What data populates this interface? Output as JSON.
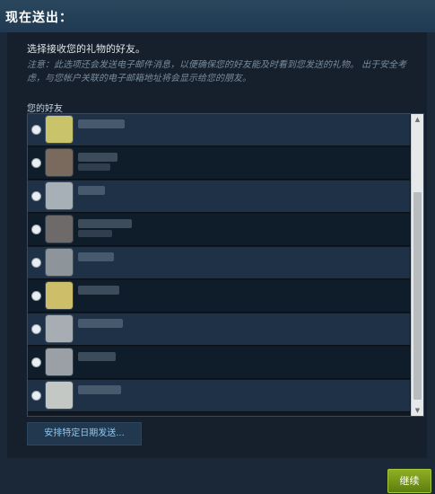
{
  "header": {
    "title": "现在送出："
  },
  "instructions": {
    "title": "选择接收您的礼物的好友。",
    "note": "注意：此选项还会发送电子邮件消息，以便确保您的好友能及时看到您发送的礼物。 出于安全考虑，与您帐户关联的电子邮箱地址将会显示给您的朋友。"
  },
  "friends": {
    "label": "您的好友",
    "rows": [
      {
        "selected": false,
        "name_visible": "",
        "avatar_color": "#c9c36a"
      },
      {
        "selected": false,
        "name_visible": "",
        "avatar_color": "#7a6a5e"
      },
      {
        "selected": false,
        "name_visible": "",
        "avatar_color": "#a7b0b7"
      },
      {
        "selected": false,
        "name_visible": "",
        "avatar_color": "#6f6a6a"
      },
      {
        "selected": false,
        "name_visible": "",
        "avatar_color": "#8d949a"
      },
      {
        "selected": false,
        "name_visible": "",
        "avatar_color": "#cdbf6a"
      },
      {
        "selected": false,
        "name_visible": "",
        "avatar_color": "#a7adb2"
      },
      {
        "selected": false,
        "name_visible": "",
        "avatar_color": "#9aa0a5"
      },
      {
        "selected": false,
        "name_visible": "",
        "avatar_color": "#c4c8c4"
      }
    ]
  },
  "buttons": {
    "schedule_label": "安排特定日期发送...",
    "continue_label": "继续"
  },
  "colors": {
    "background": "#1b2838",
    "continue_green": "#7ea21a",
    "link_blue": "#8fc7ee"
  }
}
